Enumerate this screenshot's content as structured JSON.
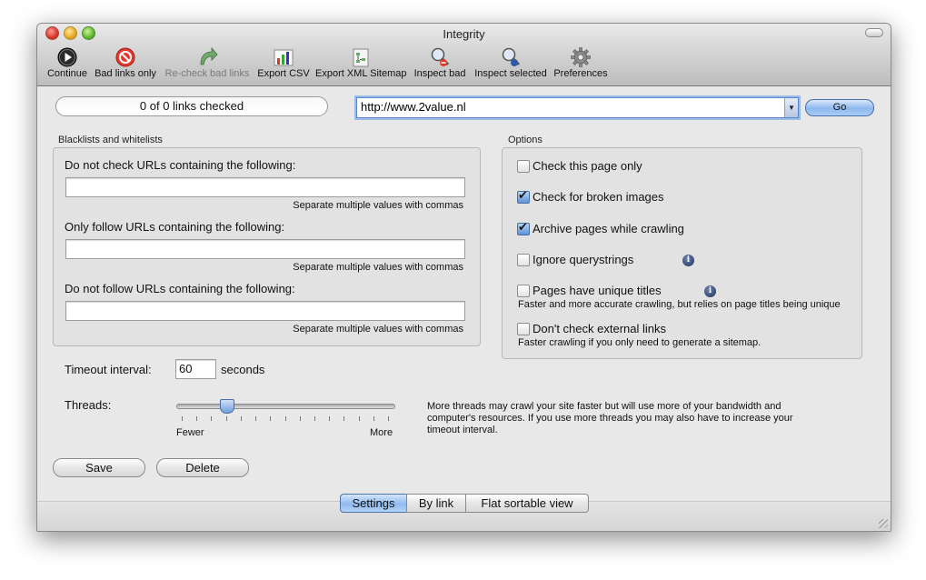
{
  "window": {
    "title": "Integrity"
  },
  "toolbar": {
    "items": [
      {
        "label": "Continue",
        "icon": "play-icon",
        "enabled": true
      },
      {
        "label": "Bad links only",
        "icon": "no-entry-icon",
        "enabled": true
      },
      {
        "label": "Re-check bad links",
        "icon": "recheck-arrow-icon",
        "enabled": false
      },
      {
        "label": "Export CSV",
        "icon": "chart-export-icon",
        "enabled": true
      },
      {
        "label": "Export XML Sitemap",
        "icon": "sitemap-export-icon",
        "enabled": true
      },
      {
        "label": "Inspect bad",
        "icon": "inspect-bad-icon",
        "enabled": true
      },
      {
        "label": "Inspect selected",
        "icon": "inspect-selected-icon",
        "enabled": true
      },
      {
        "label": "Preferences",
        "icon": "gear-icon",
        "enabled": true
      }
    ]
  },
  "status": {
    "links_checked": "0 of 0 links checked"
  },
  "url_bar": {
    "value": "http://www.2value.nl",
    "go_label": "Go"
  },
  "blacklists": {
    "title": "Blacklists and whitelists",
    "fields": [
      {
        "label": "Do not check URLs containing the following:",
        "value": "",
        "hint": "Separate multiple values with commas"
      },
      {
        "label": "Only follow URLs containing the following:",
        "value": "",
        "hint": "Separate multiple values with commas"
      },
      {
        "label": "Do not follow URLs containing the following:",
        "value": "",
        "hint": "Separate multiple values with commas"
      }
    ]
  },
  "options": {
    "title": "Options",
    "items": [
      {
        "label": "Check this page only",
        "checked": false
      },
      {
        "label": "Check for broken images",
        "checked": true
      },
      {
        "label": "Archive pages while crawling",
        "checked": true
      },
      {
        "label": "Ignore querystrings",
        "checked": false,
        "info": true
      },
      {
        "label": "Pages have unique titles",
        "checked": false,
        "info": true,
        "hint": "Faster and more accurate crawling, but relies on page titles being unique"
      },
      {
        "label": "Don't check external links",
        "checked": false,
        "hint": "Faster crawling if you only need to generate a sitemap."
      }
    ]
  },
  "timeout": {
    "label": "Timeout interval:",
    "value": "60",
    "unit": "seconds"
  },
  "threads": {
    "label": "Threads:",
    "min_label": "Fewer",
    "max_label": "More",
    "level_fraction": 0.23,
    "tick_count": 15,
    "description": "More threads may crawl your site faster but will use more of your bandwidth and computer's resources. If you use more threads you may also have to increase your timeout interval."
  },
  "buttons": {
    "save": "Save",
    "delete": "Delete"
  },
  "view_tabs": [
    {
      "label": "Settings",
      "selected": true
    },
    {
      "label": "By link",
      "selected": false
    },
    {
      "label": "Flat sortable view",
      "selected": false
    }
  ],
  "colors": {
    "accent": "#8fbaf0",
    "window_bg": "#e8e8e8"
  }
}
